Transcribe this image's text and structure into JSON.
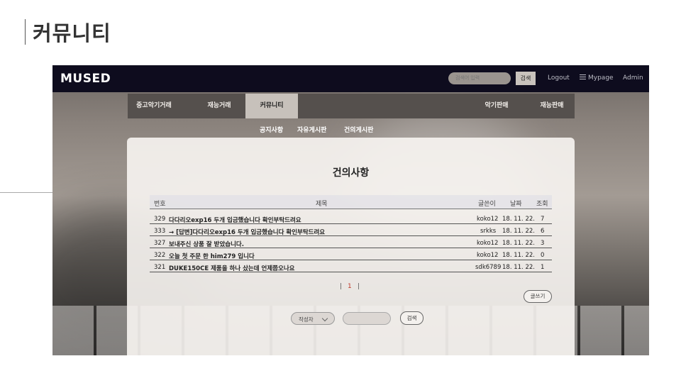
{
  "slide": {
    "title": "커뮤니티"
  },
  "site": {
    "logo": "MUSED",
    "search_placeholder": "검색어 입력",
    "search_button": "검색",
    "logout": "Logout",
    "mypage": "Mypage",
    "admin": "Admin"
  },
  "nav": {
    "items": [
      {
        "label": "중고악기거래"
      },
      {
        "label": "재능거래"
      },
      {
        "label": "커뮤니티"
      },
      {
        "label": "악기판매"
      },
      {
        "label": "재능판매"
      }
    ],
    "active": "커뮤니티"
  },
  "subnav": [
    "공지사항",
    "자유게시판",
    "건의게시판"
  ],
  "board": {
    "title": "건의사항",
    "columns": [
      "번호",
      "제목",
      "글쓴이",
      "날짜",
      "조회"
    ],
    "rows": [
      {
        "no": "329",
        "subject": "다다리오exp16 두개 입금했습니다 확인부탁드려요",
        "author": "koko12",
        "date": "18. 11. 22.",
        "views": "7"
      },
      {
        "no": "333",
        "subject": "→ [답변]다다리오exp16 두개 입금했습니다 확인부탁드려요",
        "author": "srkks",
        "date": "18. 11. 22.",
        "views": "6"
      },
      {
        "no": "327",
        "subject": "보내주신 상품 잘 받았습니다.",
        "author": "koko12",
        "date": "18. 11. 22.",
        "views": "3"
      },
      {
        "no": "322",
        "subject": "오늘 첫 주문 한 him279 입니다",
        "author": "koko12",
        "date": "18. 11. 22.",
        "views": "0"
      },
      {
        "no": "321",
        "subject": "DUKE150CE 제품을 하나 샀는데 언제쯤오나요",
        "author": "sdk6789",
        "date": "18. 11. 22.",
        "views": "1"
      }
    ],
    "pager": {
      "left": "|",
      "current": "1",
      "right": "|"
    },
    "write_button": "글쓰기",
    "search": {
      "select_value": "작성자",
      "button": "검색"
    }
  },
  "colors": {
    "topbar": "#0e0c1e",
    "nav": "#55504d",
    "nav_active": "#c7c1bb",
    "pager_active": "#c0392b"
  }
}
